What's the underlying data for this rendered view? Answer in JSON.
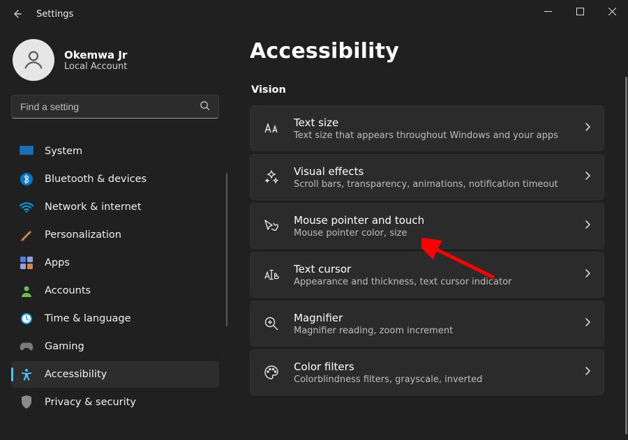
{
  "window": {
    "title": "Settings"
  },
  "user": {
    "name": "Okemwa Jr",
    "sub": "Local Account"
  },
  "search": {
    "placeholder": "Find a setting"
  },
  "nav": {
    "items": [
      {
        "id": "system",
        "label": "System",
        "iconColor": "#0a78d4"
      },
      {
        "id": "bluetooth",
        "label": "Bluetooth & devices",
        "iconColor": "#0078d4"
      },
      {
        "id": "network",
        "label": "Network & internet",
        "iconColor": "#00a4ef"
      },
      {
        "id": "personalization",
        "label": "Personalization",
        "iconColor": "#b97a44"
      },
      {
        "id": "apps",
        "label": "Apps",
        "iconColor": "#6b8fe7"
      },
      {
        "id": "accounts",
        "label": "Accounts",
        "iconColor": "#6cc04a"
      },
      {
        "id": "time",
        "label": "Time & language",
        "iconColor": "#0099e5"
      },
      {
        "id": "gaming",
        "label": "Gaming",
        "iconColor": "#8a8a8a"
      },
      {
        "id": "accessibility",
        "label": "Accessibility",
        "iconColor": "#4cc2ff"
      },
      {
        "id": "privacy",
        "label": "Privacy & security",
        "iconColor": "#8a8a8a"
      }
    ],
    "activeId": "accessibility"
  },
  "page": {
    "heading": "Accessibility",
    "section": "Vision",
    "cards": [
      {
        "id": "text-size",
        "title": "Text size",
        "sub": "Text size that appears throughout Windows and your apps"
      },
      {
        "id": "visual-effects",
        "title": "Visual effects",
        "sub": "Scroll bars, transparency, animations, notification timeout"
      },
      {
        "id": "mouse-pointer",
        "title": "Mouse pointer and touch",
        "sub": "Mouse pointer color, size"
      },
      {
        "id": "text-cursor",
        "title": "Text cursor",
        "sub": "Appearance and thickness, text cursor indicator"
      },
      {
        "id": "magnifier",
        "title": "Magnifier",
        "sub": "Magnifier reading, zoom increment"
      },
      {
        "id": "color-filters",
        "title": "Color filters",
        "sub": "Colorblindness filters, grayscale, inverted"
      }
    ]
  },
  "colors": {
    "accent": "#4cc2ff",
    "cardBg": "#2b2b2b",
    "bg": "#202020"
  }
}
